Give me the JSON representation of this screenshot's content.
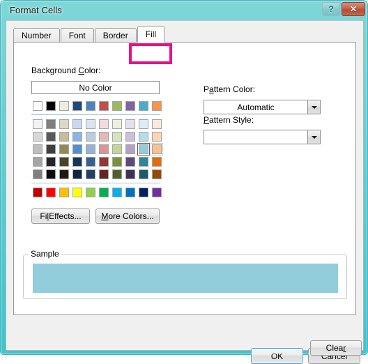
{
  "window": {
    "title": "Format Cells",
    "help_button": "?",
    "close_button": "✕",
    "accent_border": "#3fc3cc",
    "highlight_color": "#ea0f8a"
  },
  "tabs": [
    {
      "label": "Number",
      "active": false
    },
    {
      "label": "Font",
      "active": false
    },
    {
      "label": "Border",
      "active": false
    },
    {
      "label": "Fill",
      "active": true
    }
  ],
  "fill_tab": {
    "background_color": {
      "label_pre": "Background ",
      "label_accel": "C",
      "label_post": "olor:",
      "no_color_button": "No Color"
    },
    "pattern_color": {
      "label_pre": "P",
      "label_accel": "a",
      "label_post": "ttern Color:",
      "value": "Automatic"
    },
    "pattern_style": {
      "label_pre": "",
      "label_accel": "P",
      "label_post": "attern Style:",
      "value": ""
    },
    "fill_effects_button": {
      "pre": "Fi",
      "accel": "l",
      "post": " Effects..."
    },
    "more_colors_button": {
      "pre": "",
      "accel": "M",
      "post": "ore Colors..."
    },
    "sample": {
      "legend": "Sample",
      "color": "#92cddc"
    }
  },
  "palette": {
    "theme_colors": [
      "#ffffff",
      "#000000",
      "#eeece1",
      "#1f497d",
      "#4f81bd",
      "#c0504d",
      "#9bbb59",
      "#8064a2",
      "#4bacc6",
      "#f79646"
    ],
    "tint_rows": [
      [
        "#f2f2f2",
        "#7f7f7f",
        "#ddd9c3",
        "#c6d9f0",
        "#dbe5f1",
        "#f2dcdb",
        "#ebf1dd",
        "#e5e0ec",
        "#dbeef3",
        "#fdeada"
      ],
      [
        "#d8d8d8",
        "#595959",
        "#c4bd97",
        "#8db3e2",
        "#b8cce4",
        "#e5b8b7",
        "#d7e3bc",
        "#ccc0d9",
        "#b7dde8",
        "#fbd5b5"
      ],
      [
        "#bfbfbf",
        "#3f3f3f",
        "#938953",
        "#548dd4",
        "#95b3d7",
        "#d99694",
        "#c3d69b",
        "#b2a2c7",
        "#92cddc",
        "#fac08f"
      ],
      [
        "#a5a5a5",
        "#262626",
        "#494429",
        "#17365d",
        "#366092",
        "#953734",
        "#76923c",
        "#5f497a",
        "#31859b",
        "#e36c09"
      ],
      [
        "#7f7f7f",
        "#0c0c0c",
        "#1d1b10",
        "#0f243e",
        "#244061",
        "#632423",
        "#4f6128",
        "#3f3151",
        "#205867",
        "#974806"
      ]
    ],
    "standard_colors": [
      "#c00000",
      "#ff0000",
      "#ffc000",
      "#ffff00",
      "#92d050",
      "#00b050",
      "#00b0f0",
      "#0070c0",
      "#002060",
      "#7030a0"
    ],
    "selected": {
      "row": 2,
      "col": 8,
      "color": "#92cddc"
    },
    "hovered": {
      "row": 2,
      "col": 9,
      "color": "#fac08f"
    }
  },
  "footer": {
    "clear_button": {
      "pre": "Clea",
      "accel": "r",
      "post": ""
    },
    "ok_button": "OK",
    "cancel_button": "Cancel"
  }
}
